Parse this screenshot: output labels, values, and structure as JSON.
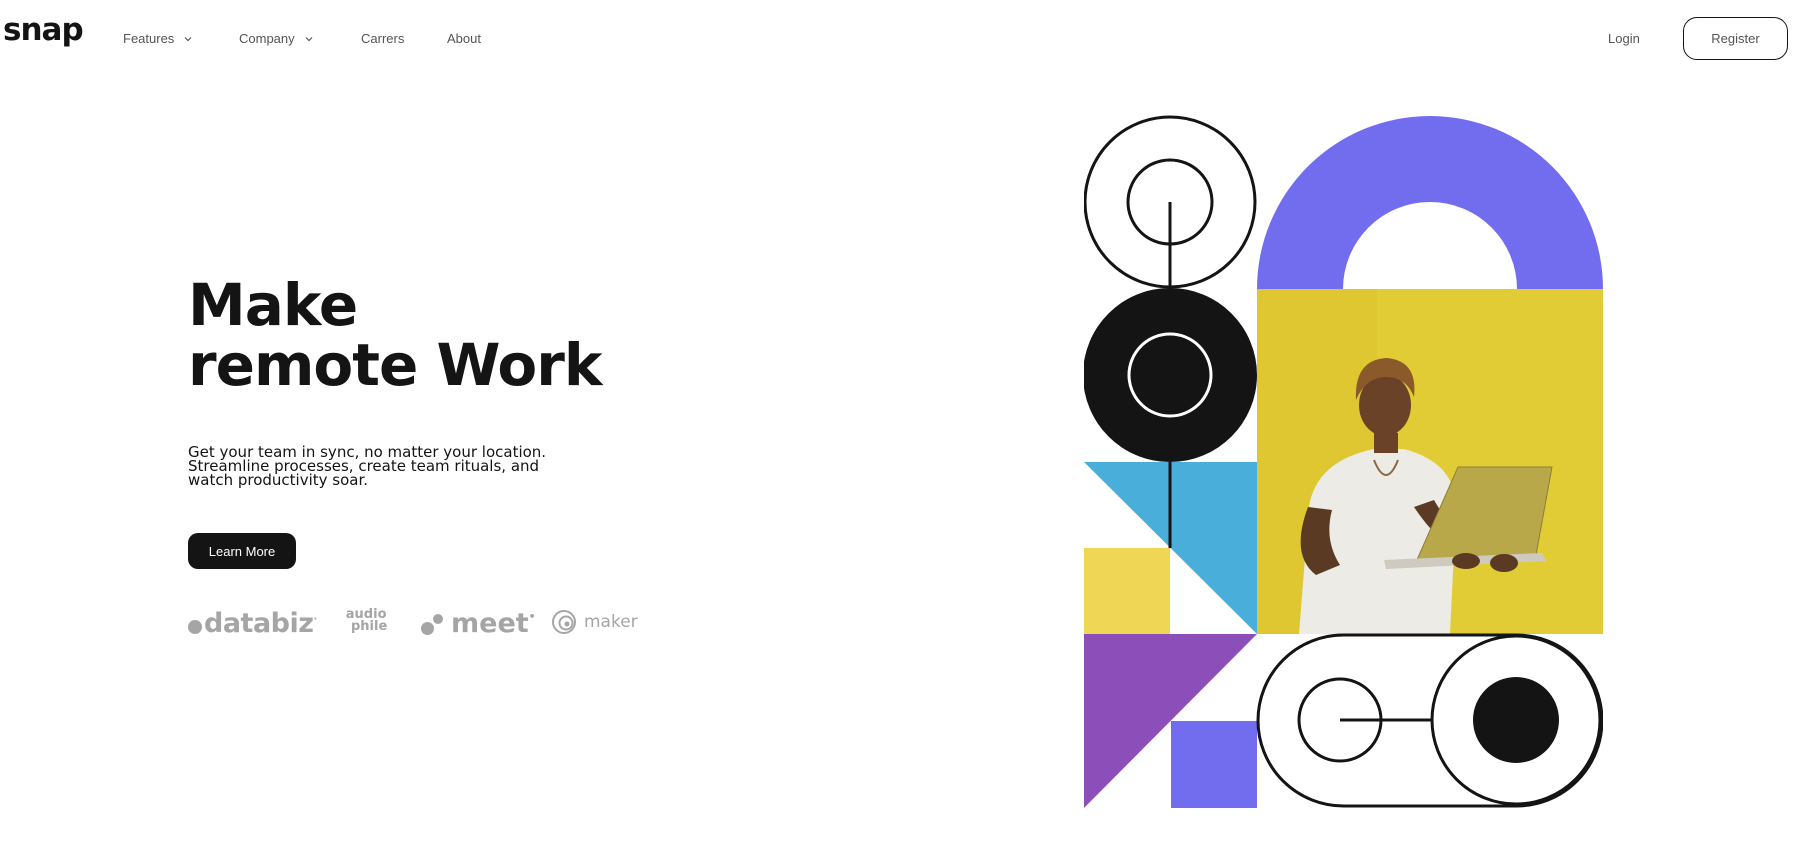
{
  "brand": {
    "logo": "snap"
  },
  "nav": {
    "items": [
      {
        "label": "Features",
        "has_dropdown": true
      },
      {
        "label": "Company",
        "has_dropdown": true
      },
      {
        "label": "Carrers",
        "has_dropdown": false
      },
      {
        "label": "About",
        "has_dropdown": false
      }
    ],
    "login": "Login",
    "register": "Register"
  },
  "hero": {
    "headline_line1": "Make",
    "headline_line2": "remote Work",
    "subtext_line1": "Get your team in sync, no matter your location.",
    "subtext_line2": "Streamline processes, create team rituals, and",
    "subtext_line3": "watch productivity soar.",
    "cta": "Learn More"
  },
  "clients": {
    "databiz": {
      "name": "databiz",
      "mark": "·"
    },
    "audiophile": {
      "line1": "audio",
      "line2": "phile"
    },
    "meet": {
      "name": "meet",
      "mark": "•"
    },
    "maker": {
      "name": "maker"
    }
  },
  "colors": {
    "ink": "#141414",
    "muted_text": "#555555",
    "client_gray": "#a5a5a5",
    "violet": "#726cee",
    "yellow": "#e2cc35",
    "sky_blue": "#4aaedb",
    "soft_yellow": "#efd655",
    "purple": "#8c4eb9"
  },
  "illustration": {
    "subject": "person-with-laptop-illustration"
  }
}
